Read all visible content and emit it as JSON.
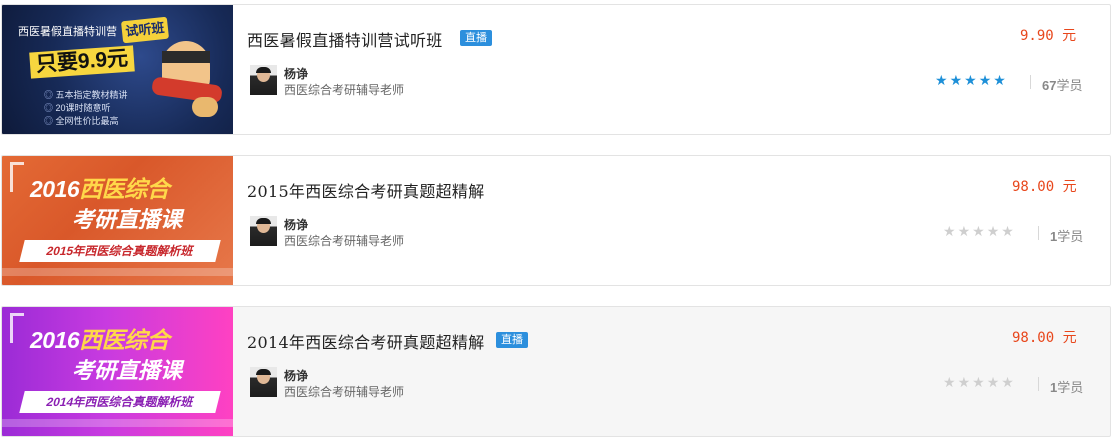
{
  "courses": [
    {
      "banner": {
        "style": "dark",
        "top_line": "西医暑假直播特训营",
        "tag": "试听班",
        "headline": "只要9.9元",
        "bullets": [
          "五本指定教材精讲",
          "20课时随意听",
          "全网性价比最高"
        ]
      },
      "title": "西医暑假直播特训营试听班",
      "badge": "直播",
      "teacher": {
        "name": "杨诤",
        "role": "西医综合考研辅导老师"
      },
      "price": "9.90 元",
      "rating": {
        "filled": 5,
        "total": 5
      },
      "students_count": "67",
      "students_suffix": "学员"
    },
    {
      "banner": {
        "style": "orange",
        "line1_a": "2016",
        "line1_b": "西医综合",
        "line2": "考研直播课",
        "ribbon": "2015年西医综合真题解析班"
      },
      "title": "2015年西医综合考研真题超精解",
      "badge": "",
      "teacher": {
        "name": "杨诤",
        "role": "西医综合考研辅导老师"
      },
      "price": "98.00 元",
      "rating": {
        "filled": 0,
        "total": 5
      },
      "students_count": "1",
      "students_suffix": "学员"
    },
    {
      "banner": {
        "style": "purple",
        "line1_a": "2016",
        "line1_b": "西医综合",
        "line2": "考研直播课",
        "ribbon": "2014年西医综合真题解析班"
      },
      "title": "2014年西医综合考研真题超精解",
      "badge": "直播",
      "teacher": {
        "name": "杨诤",
        "role": "西医综合考研辅导老师"
      },
      "price": "98.00 元",
      "rating": {
        "filled": 0,
        "total": 5
      },
      "students_count": "1",
      "students_suffix": "学员"
    }
  ],
  "colors": {
    "price": "#e8471c",
    "badge": "#2c8fdd",
    "star_on": "#1e90d8",
    "star_off": "#cfcfcf"
  },
  "icons": {
    "star": "star-icon",
    "avatar": "teacher-avatar"
  }
}
